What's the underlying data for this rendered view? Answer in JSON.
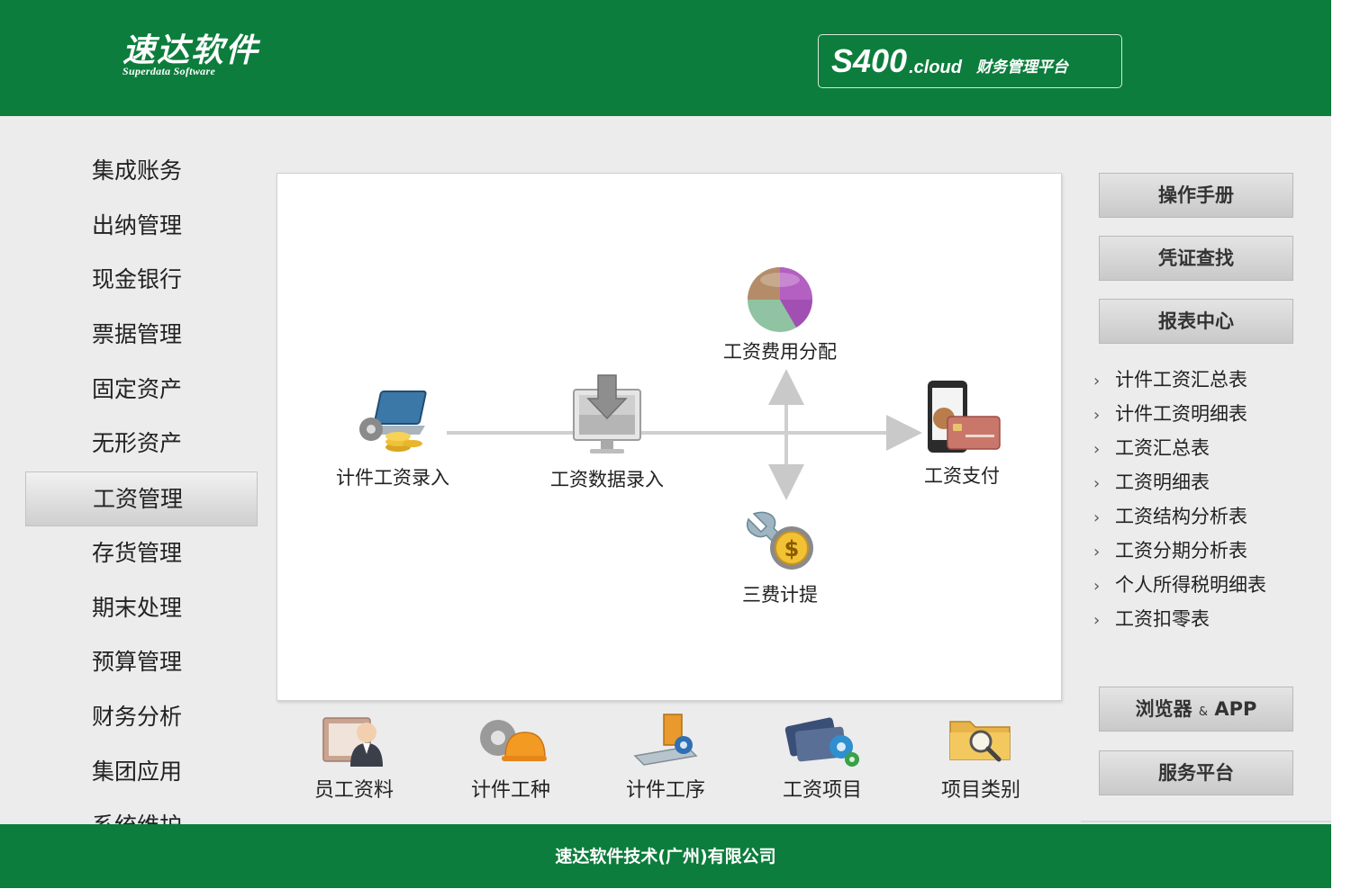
{
  "header": {
    "logo_main": "速达软件",
    "logo_sub": "Superdata Software",
    "product_name": "S400",
    "product_sub": ".cloud",
    "product_tag": "财务管理平台",
    "bg_color": "#0c7d3c"
  },
  "left_nav": {
    "active_index": 6,
    "items": [
      {
        "label": "集成账务"
      },
      {
        "label": "出纳管理"
      },
      {
        "label": "现金银行"
      },
      {
        "label": "票据管理"
      },
      {
        "label": "固定资产"
      },
      {
        "label": "无形资产"
      },
      {
        "label": "工资管理"
      },
      {
        "label": "存货管理"
      },
      {
        "label": "期末处理"
      },
      {
        "label": "预算管理"
      },
      {
        "label": "财务分析"
      },
      {
        "label": "集团应用"
      },
      {
        "label": "系统维护"
      }
    ]
  },
  "flow": {
    "piece_wage_entry": {
      "label": "计件工资录入",
      "icon": "laptop-coins-icon"
    },
    "wage_data_entry": {
      "label": "工资数据录入",
      "icon": "download-monitor-icon"
    },
    "wage_cost_allocation": {
      "label": "工资费用分配",
      "icon": "pie-chart-icon"
    },
    "wage_payment": {
      "label": "工资支付",
      "icon": "phone-card-icon"
    },
    "three_fees_accrual": {
      "label": "三费计提",
      "icon": "wrench-dollar-icon"
    }
  },
  "bottom_icons": [
    {
      "label": "员工资料",
      "icon": "employee-folder-icon"
    },
    {
      "label": "计件工种",
      "icon": "gear-helmet-icon"
    },
    {
      "label": "计件工序",
      "icon": "process-tools-icon"
    },
    {
      "label": "工资项目",
      "icon": "cards-gears-icon"
    },
    {
      "label": "项目类别",
      "icon": "folder-magnifier-icon"
    }
  ],
  "right_panel": {
    "top_buttons": [
      {
        "label": "操作手册"
      },
      {
        "label": "凭证查找"
      },
      {
        "label": "报表中心"
      }
    ],
    "report_links": [
      {
        "label": "计件工资汇总表"
      },
      {
        "label": "计件工资明细表"
      },
      {
        "label": "工资汇总表"
      },
      {
        "label": "工资明细表"
      },
      {
        "label": "工资结构分析表"
      },
      {
        "label": "工资分期分析表"
      },
      {
        "label": "个人所得税明细表"
      },
      {
        "label": "工资扣零表"
      }
    ],
    "browser_app": {
      "label_main": "浏览器",
      "label_amp": "&",
      "label_app": "APP"
    },
    "service_platform": {
      "label": "服务平台"
    }
  },
  "footer": {
    "company": "速达软件技术(广州)有限公司"
  }
}
